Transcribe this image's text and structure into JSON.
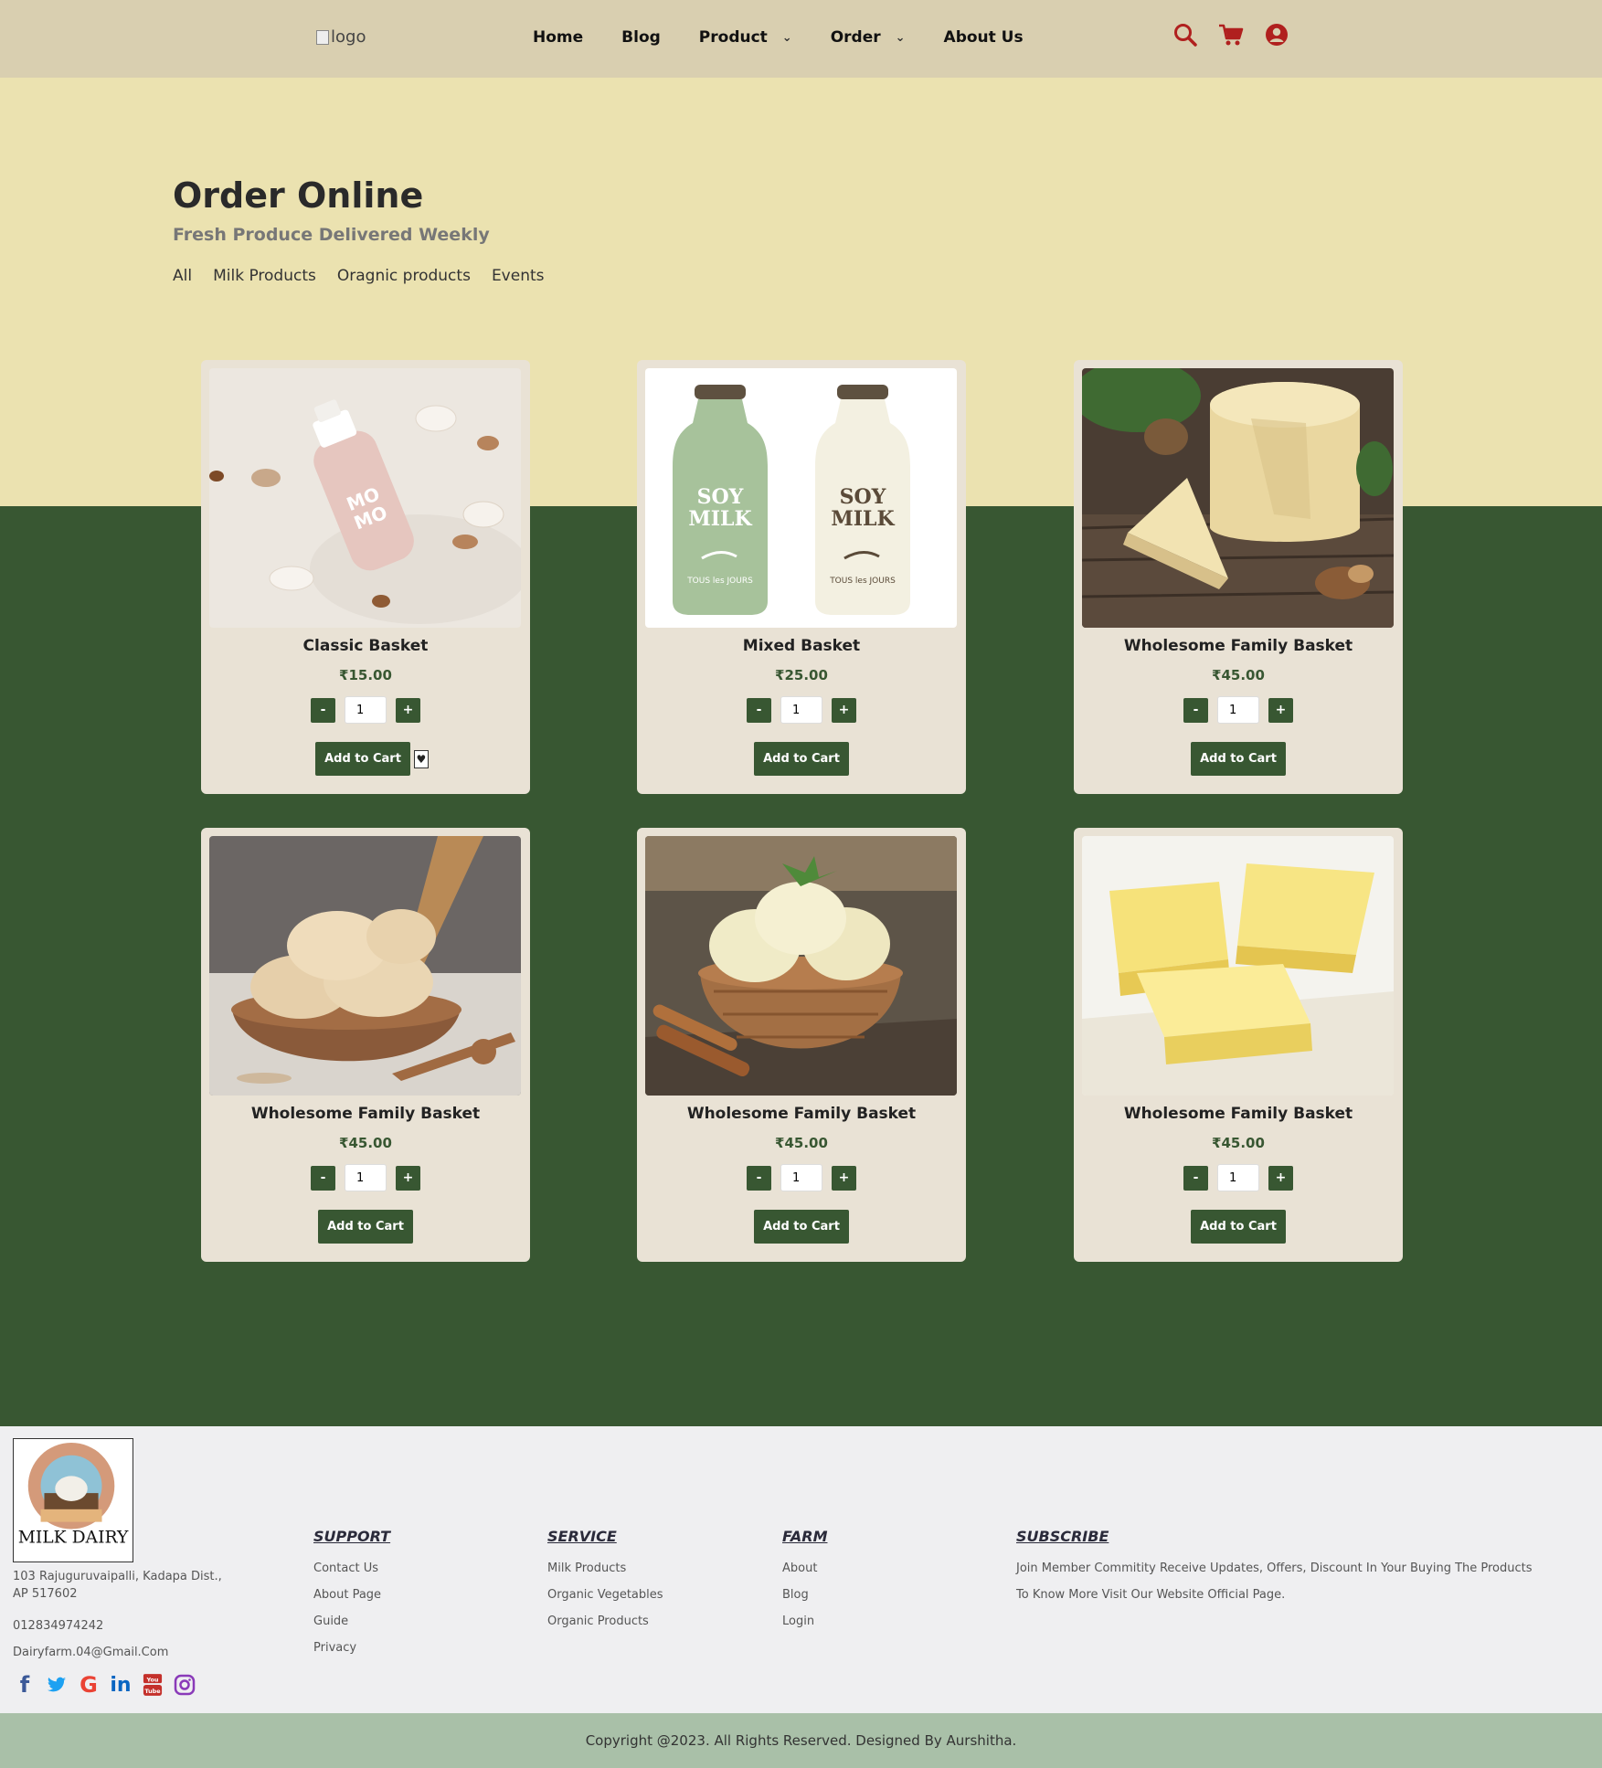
{
  "header": {
    "logo_alt": "logo",
    "nav": [
      "Home",
      "Blog",
      "Product",
      "Order",
      "About Us"
    ],
    "accent": "#b0201e"
  },
  "hero": {
    "title": "Order Online",
    "subtitle": "Fresh Produce Delivered Weekly",
    "filters": [
      "All",
      "Milk Products",
      "Oragnic products",
      "Events"
    ]
  },
  "products": [
    {
      "name": "Classic Basket",
      "price": "₹15.00",
      "qty": "1",
      "minus": "-",
      "plus": "+",
      "cta": "Add to Cart",
      "image": "milk-bottle-almonds"
    },
    {
      "name": "Mixed Basket",
      "price": "₹25.00",
      "qty": "1",
      "minus": "-",
      "plus": "+",
      "cta": "Add to Cart",
      "image": "soy-milk-bottles"
    },
    {
      "name": "Wholesome Family Basket",
      "price": "₹45.00",
      "qty": "1",
      "minus": "-",
      "plus": "+",
      "cta": "Add to Cart",
      "image": "cheese-wheel"
    },
    {
      "name": "Wholesome Family Basket",
      "price": "₹45.00",
      "qty": "1",
      "minus": "-",
      "plus": "+",
      "cta": "Add to Cart",
      "image": "ice-cream-bowl"
    },
    {
      "name": "Wholesome Family Basket",
      "price": "₹45.00",
      "qty": "1",
      "minus": "-",
      "plus": "+",
      "cta": "Add to Cart",
      "image": "vanilla-ice-cream"
    },
    {
      "name": "Wholesome Family Basket",
      "price": "₹45.00",
      "qty": "1",
      "minus": "-",
      "plus": "+",
      "cta": "Add to Cart",
      "image": "butter-blocks"
    }
  ],
  "footer": {
    "brand": "MILK DAIRY",
    "address": "103 Rajuguruvaipalli, Kadapa Dist., AP 517602",
    "phone": "012834974242",
    "email": "Dairyfarm.04@Gmail.Com",
    "support": {
      "title": "SUPPORT",
      "links": [
        "Contact Us",
        "About Page",
        "Guide",
        "Privacy"
      ]
    },
    "service": {
      "title": "SERVICE",
      "links": [
        "Milk Products",
        "Organic Vegetables",
        "Organic Products"
      ]
    },
    "farm": {
      "title": "FARM",
      "links": [
        "About",
        "Blog",
        "Login"
      ]
    },
    "subscribe": {
      "title": "SUBSCRIBE",
      "lines": [
        "Join Member Commitity Receive Updates, Offers, Discount In Your Buying The Products",
        "To Know More Visit Our Website Official Page."
      ]
    },
    "social_icons": [
      "facebook-icon",
      "twitter-icon",
      "google-icon",
      "linkedin-icon",
      "youtube-icon",
      "instagram-icon"
    ],
    "copyright": "Copyright @2023. All Rights Reserved. Designed By Aurshitha."
  },
  "colors": {
    "green": "#385732",
    "cream": "#ebe2b0",
    "header": "#d9cfb0",
    "card": "#e9e2d5"
  }
}
